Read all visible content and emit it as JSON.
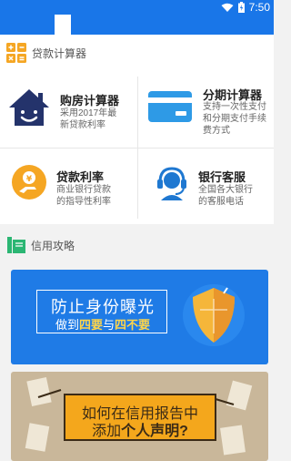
{
  "status_bar": {
    "time": "7:50",
    "icons": [
      "wifi-icon",
      "battery-icon"
    ]
  },
  "sections": {
    "calculators": {
      "label": "贷款计算器",
      "icon": "calculator-icon"
    },
    "credit": {
      "label": "信用攻略",
      "icon": "book-icon"
    }
  },
  "tools": [
    {
      "title": "购房计算器",
      "desc1": "采用2017年最",
      "desc2": "新贷款利率",
      "icon": "house-icon"
    },
    {
      "title": "分期计算器",
      "desc1": "支持一次性支付",
      "desc2": "和分期支付手续",
      "desc3": "费方式",
      "icon": "card-icon"
    },
    {
      "title": "贷款利率",
      "desc1": "商业银行贷款",
      "desc2": "的指导性利率",
      "icon": "coin-hand-icon"
    },
    {
      "title": "银行客服",
      "desc1": "全国各大银行",
      "desc2": "的客服电话",
      "icon": "headset-icon"
    }
  ],
  "banners": [
    {
      "line1": "防止身份曝光",
      "line2_pre": "做到",
      "line2_em1": "四要",
      "line2_mid": "与",
      "line2_em2": "四不要",
      "icon": "shield-icon"
    },
    {
      "line1": "如何在信用报告中",
      "line2_pre": "添加",
      "line2_em": "个人声明?"
    }
  ],
  "colors": {
    "primary": "#1976e8",
    "accent_yellow": "#ffd54a",
    "orange": "#f4a71c"
  }
}
